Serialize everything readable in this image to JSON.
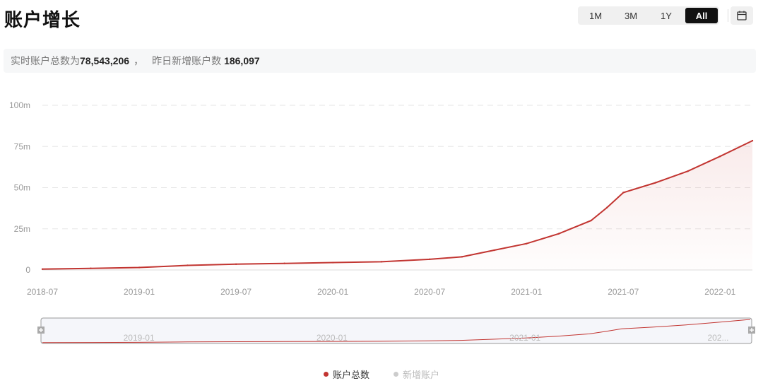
{
  "header": {
    "title": "账户增长",
    "ranges": [
      "1M",
      "3M",
      "1Y",
      "All"
    ],
    "active_range": "All",
    "calendar_icon": "calendar-icon"
  },
  "summary": {
    "total_label": "实时账户总数为",
    "total_value": "78,543,206",
    "separator": "，",
    "new_label": "昨日新增账户数",
    "new_value": "186,097"
  },
  "colors": {
    "series_main": "#c23531",
    "series_secondary": "#cccccc",
    "grid": "#e6e6e6"
  },
  "chart_data": {
    "type": "area",
    "ylim": [
      0,
      100
    ],
    "y_ticks": [
      "0",
      "25m",
      "50m",
      "75m",
      "100m"
    ],
    "y_tick_values": [
      0,
      25,
      50,
      75,
      100
    ],
    "x_ticks": [
      "2018-07",
      "2019-01",
      "2019-07",
      "2020-01",
      "2020-07",
      "2021-01",
      "2021-07",
      "2022-01"
    ],
    "x_tick_months": [
      0,
      6,
      12,
      18,
      24,
      30,
      36,
      42
    ],
    "grid": true,
    "legend_position": "bottom",
    "series": [
      {
        "name": "账户总数",
        "x": [
          "2018-07",
          "2018-10",
          "2019-01",
          "2019-04",
          "2019-07",
          "2019-10",
          "2020-01",
          "2020-04",
          "2020-07",
          "2020-09",
          "2020-11",
          "2021-01",
          "2021-03",
          "2021-05",
          "2021-06",
          "2021-07",
          "2021-09",
          "2021-11",
          "2022-01",
          "2022-03"
        ],
        "values": [
          0.5,
          1.0,
          1.5,
          2.8,
          3.5,
          4.0,
          4.5,
          5.0,
          6.5,
          8.0,
          12.0,
          16.0,
          22.0,
          30.0,
          38.0,
          47.0,
          53.0,
          60.0,
          69.0,
          78.5
        ]
      },
      {
        "name": "新增账户",
        "x": [],
        "values": []
      }
    ]
  },
  "navigator": {
    "labels": [
      "2019-01",
      "2020-01",
      "2021-01",
      "202..."
    ],
    "label_months": [
      6,
      18,
      30,
      42
    ]
  }
}
